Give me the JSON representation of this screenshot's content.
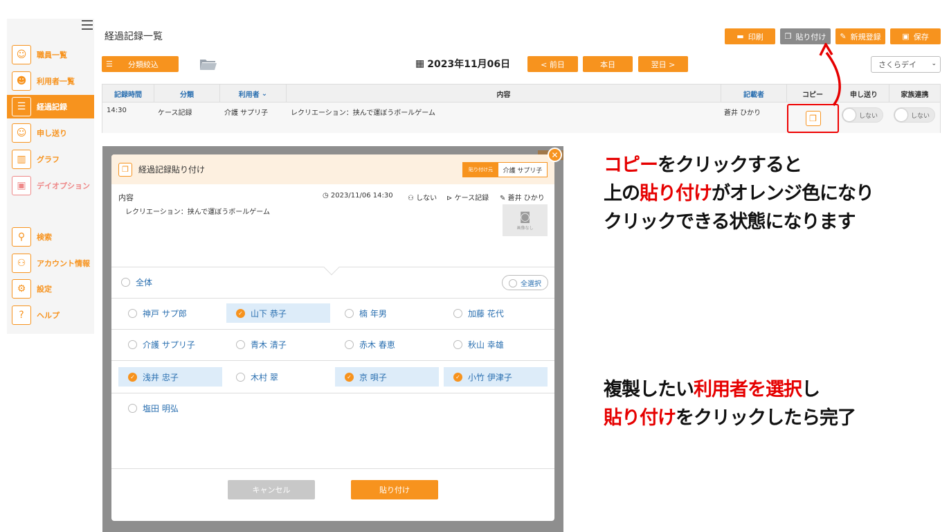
{
  "sidebar": {
    "items": [
      {
        "label": "職員一覧",
        "icon": "staff-icon"
      },
      {
        "label": "利用者一覧",
        "icon": "user-list-icon"
      },
      {
        "label": "経過記録",
        "icon": "clipboard-icon"
      },
      {
        "label": "申し送り",
        "icon": "handover-icon"
      },
      {
        "label": "グラフ",
        "icon": "chart-icon"
      },
      {
        "label": "デイオプション",
        "icon": "bus-icon"
      },
      {
        "label": "検索",
        "icon": "search-icon"
      },
      {
        "label": "アカウント情報",
        "icon": "account-icon"
      },
      {
        "label": "設定",
        "icon": "gear-icon"
      },
      {
        "label": "ヘルプ",
        "icon": "help-icon"
      }
    ]
  },
  "header": {
    "title": "経過記録一覧",
    "print_label": "印刷",
    "paste_label": "貼り付け",
    "new_label": "新規登録",
    "save_label": "保存",
    "filter_label": "分類絞込",
    "date": "2023年11月06日",
    "prev_label": "< 前日",
    "today_label": "本日",
    "next_label": "翌日 >",
    "facility": "さくらデイ"
  },
  "table": {
    "columns": [
      "記録時間",
      "分類",
      "利用者",
      "内容",
      "記載者",
      "コピー",
      "申し送り",
      "家族連携"
    ],
    "row": {
      "time": "14:30",
      "category": "ケース記録",
      "user": "介護 サプリ子",
      "content": "レクリエーション：挟んで運ぼうボールゲーム",
      "author": "蒼井 ひかり",
      "handover": "しない",
      "family": "しない"
    }
  },
  "modal": {
    "title": "経過記録貼り付け",
    "source_tag": "貼り付け元",
    "source_user": "介護 サプリ子",
    "content_label": "内容",
    "datetime": "2023/11/06 14:30",
    "handover": "しない",
    "category": "ケース記録",
    "author": "蒼井 ひかり",
    "content": "レクリエーション：挟んで運ぼうボールゲーム",
    "no_image": "画像なし",
    "all_label": "全体",
    "select_all": "全選択",
    "users": [
      {
        "name": "神戸 サプ郎",
        "selected": false
      },
      {
        "name": "山下 恭子",
        "selected": true
      },
      {
        "name": "楠 年男",
        "selected": false
      },
      {
        "name": "加藤 花代",
        "selected": false
      },
      {
        "name": "介護 サプリ子",
        "selected": false
      },
      {
        "name": "青木 清子",
        "selected": false
      },
      {
        "name": "赤木 春恵",
        "selected": false
      },
      {
        "name": "秋山 幸雄",
        "selected": false
      },
      {
        "name": "浅井 忠子",
        "selected": true
      },
      {
        "name": "木村 翠",
        "selected": false
      },
      {
        "name": "京 唄子",
        "selected": true
      },
      {
        "name": "小竹 伊津子",
        "selected": true
      },
      {
        "name": "塩田 明弘",
        "selected": false
      }
    ],
    "cancel_label": "キャンセル",
    "paste_label": "貼り付け"
  },
  "notes": {
    "top": {
      "l1a": "コピー",
      "l1b": "をクリックすると",
      "l2a": "上の",
      "l2b": "貼り付け",
      "l2c": "がオレンジ色になり",
      "l3": "クリックできる状態になります"
    },
    "bottom": {
      "l1a": "複製したい",
      "l1b": "利用者を選択",
      "l1c": "し",
      "l2a": "貼り付け",
      "l2b": "をクリックしたら完了"
    }
  },
  "colors": {
    "accent": "#f7931e",
    "highlight": "#e60000",
    "link": "#2a6fb0"
  }
}
